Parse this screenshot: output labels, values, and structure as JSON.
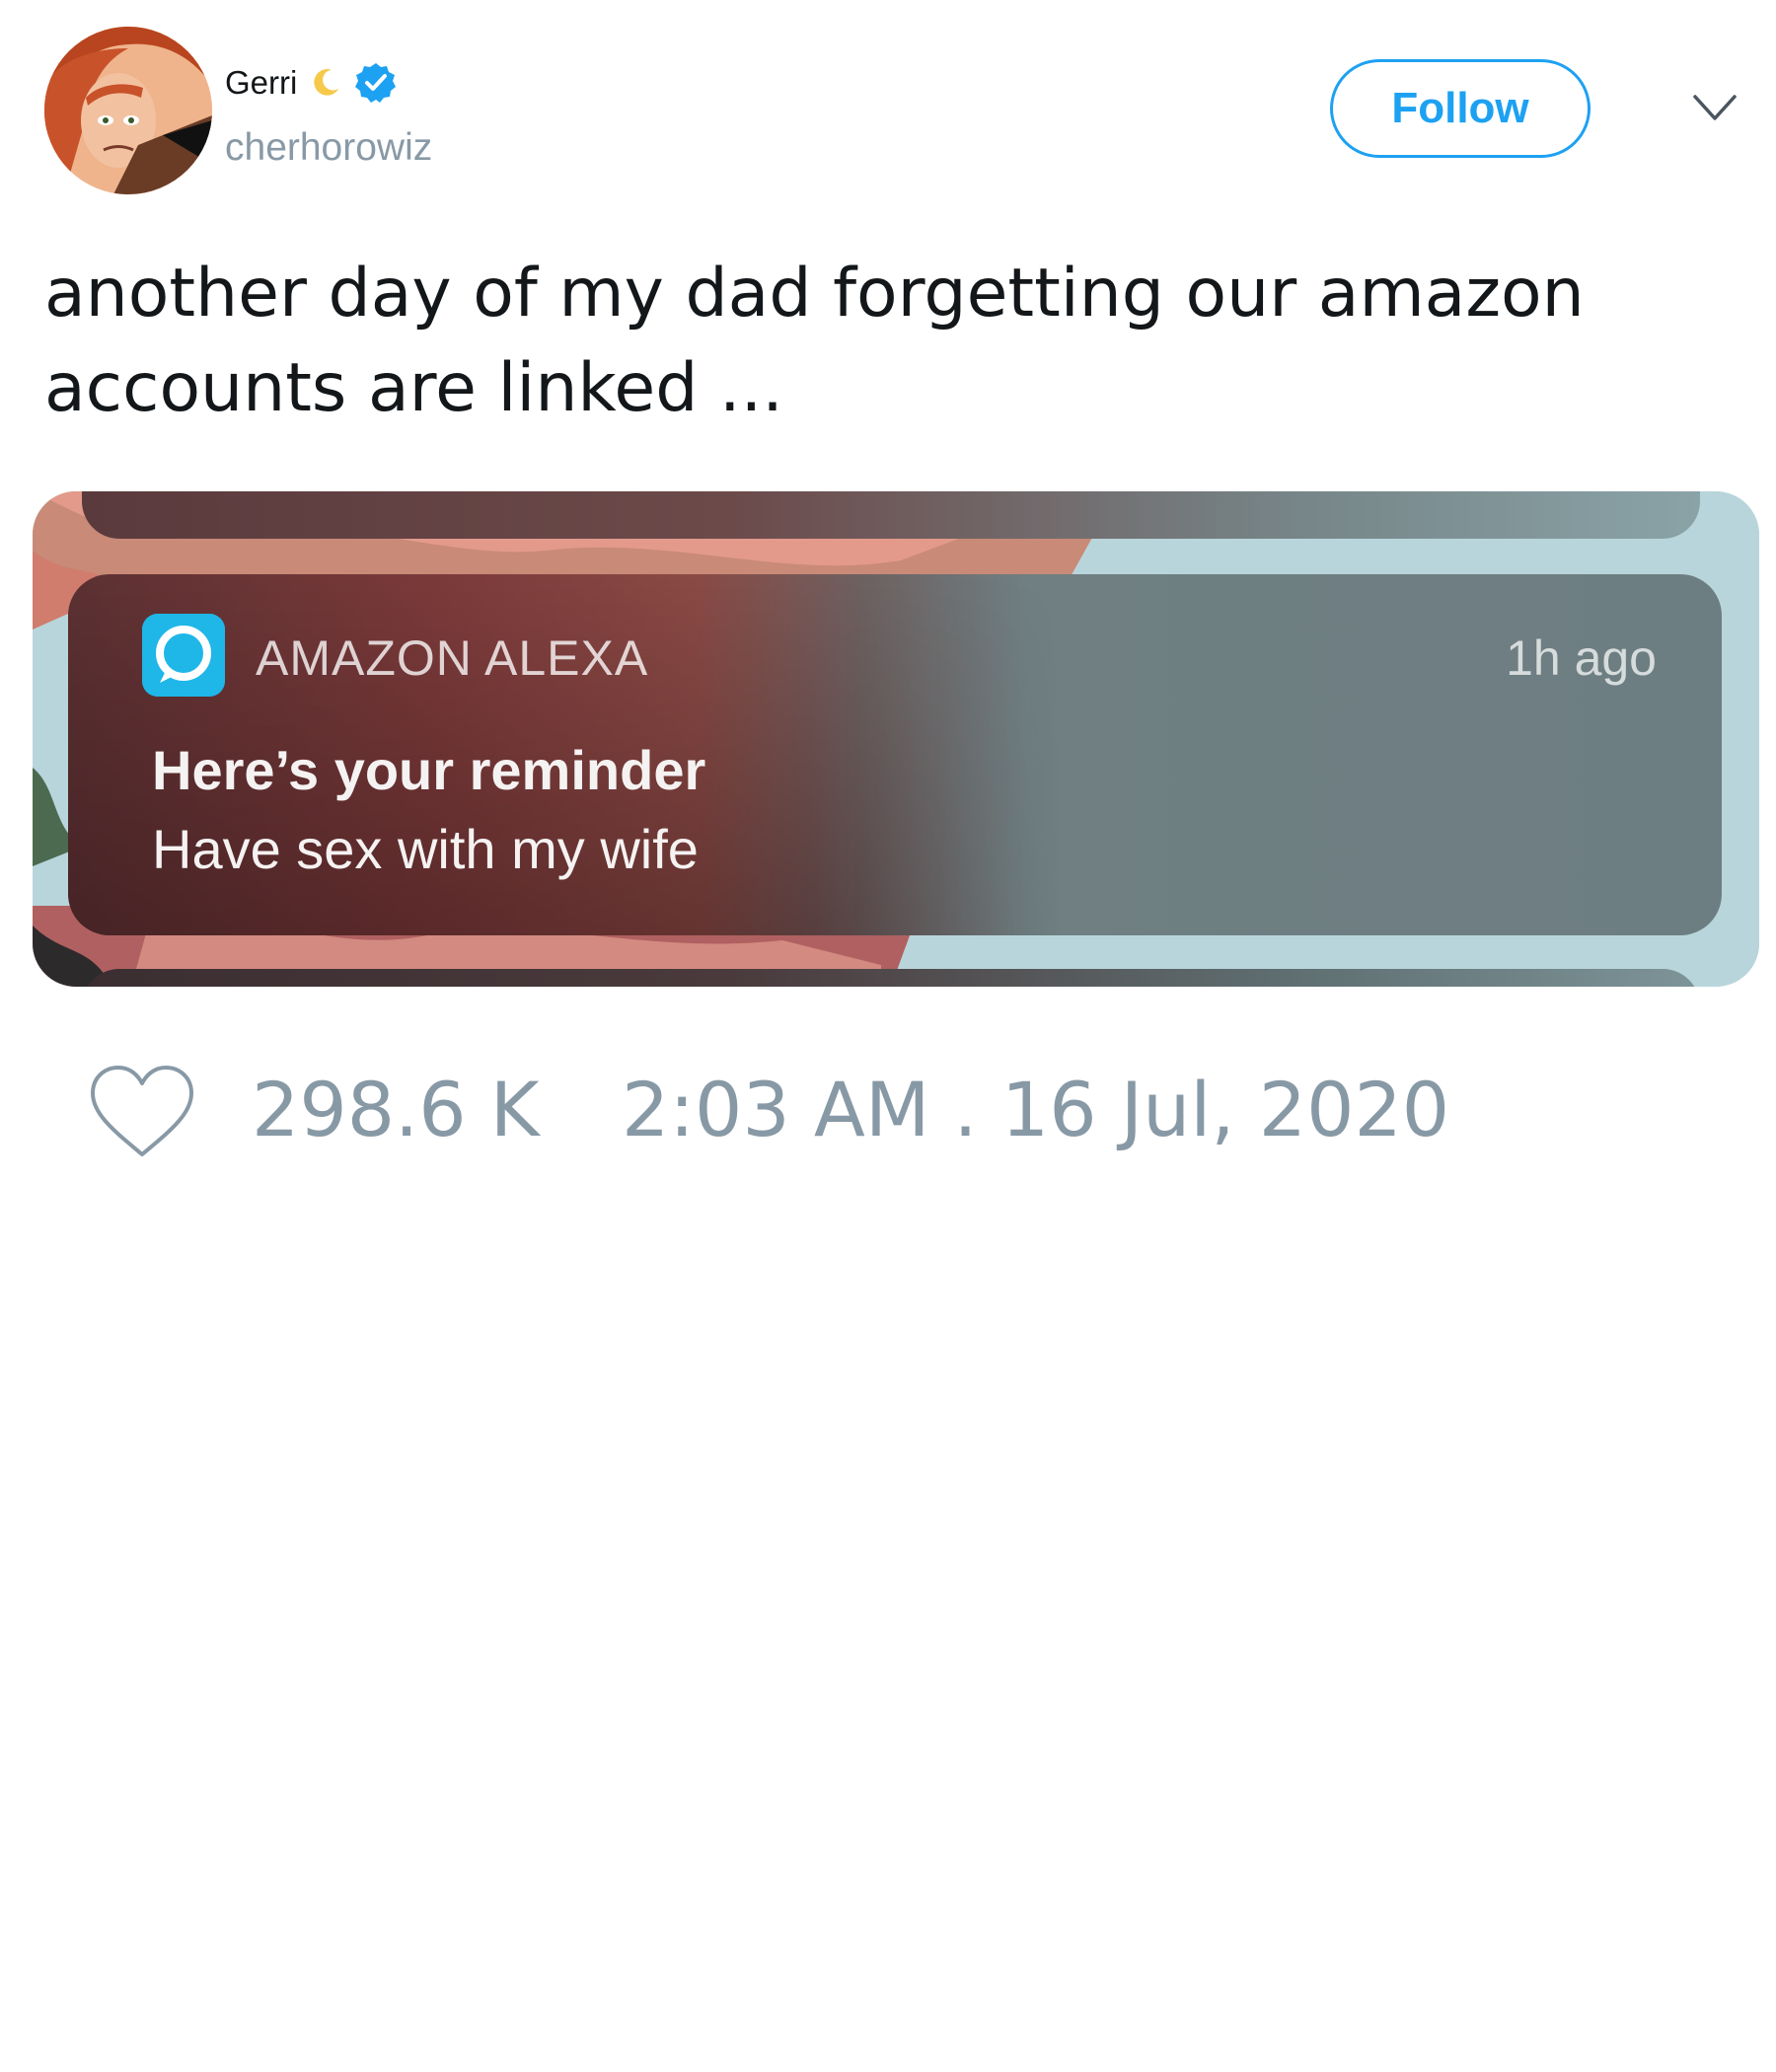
{
  "user": {
    "display_name": "Gerri",
    "handle": "cherhorowiz"
  },
  "follow_button": {
    "label": "Follow"
  },
  "tweet": {
    "text": "another day of my dad forgetting our amazon accounts are linked ..."
  },
  "notification": {
    "app_name": "AMAZON ALEXA",
    "time": "1h ago",
    "title": "Here’s your reminder",
    "body": "Have sex with my wife"
  },
  "footer": {
    "like_count": "298.6 K",
    "timestamp": "2:03 AM . 16 Jul, 2020"
  },
  "icons": {
    "avatar": "avatar-cartoon",
    "name_emoji": "moon-icon",
    "verified": "verified-badge-icon",
    "menu": "chevron-down-icon",
    "app": "alexa-ring-icon",
    "like": "heart-outline-icon"
  },
  "colors": {
    "accent": "#1da1f2",
    "muted": "#8899a6",
    "text": "#14171a",
    "alexa": "#1fb6e8"
  }
}
